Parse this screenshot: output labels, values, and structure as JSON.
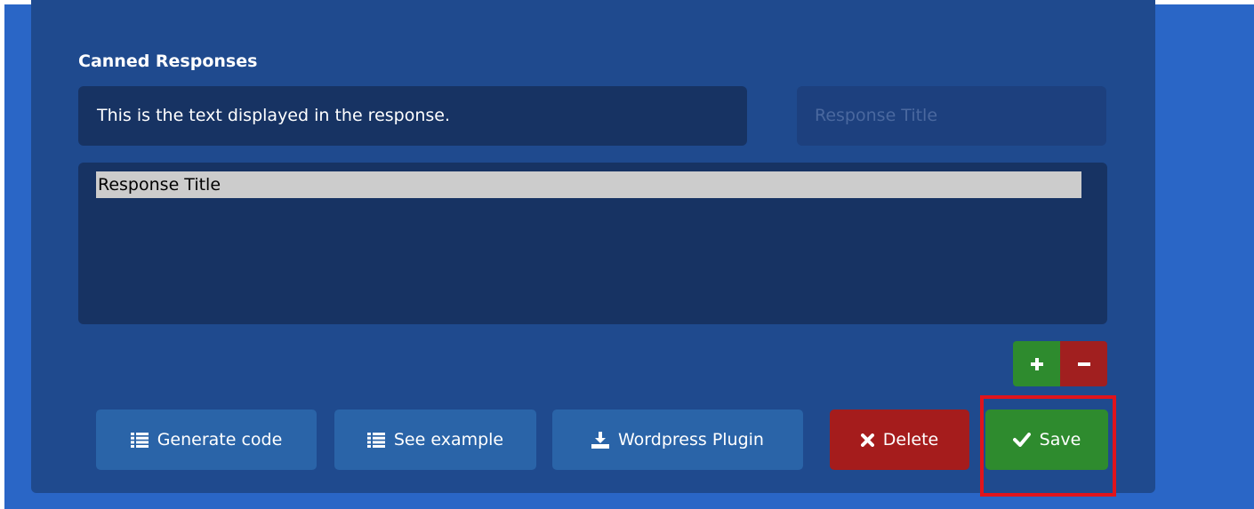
{
  "colors": {
    "page_bg": "#2a66c6",
    "panel_bg": "#1f4a8e",
    "input_bg": "#173363",
    "button_blue": "#2a64a8",
    "button_red": "#a51c1c",
    "button_green": "#2e8b2e",
    "highlight": "#e0141c"
  },
  "section_title": "Canned Responses",
  "response_text": {
    "value": "This is the text displayed in the response."
  },
  "response_title_input": {
    "placeholder": "Response Title"
  },
  "responses_list": {
    "items": [
      {
        "label": "Response Title",
        "selected": true
      }
    ]
  },
  "list_controls": {
    "add_icon": "plus-icon",
    "remove_icon": "minus-icon"
  },
  "buttons": {
    "generate_code": {
      "label": "Generate code",
      "icon": "list-icon"
    },
    "see_example": {
      "label": "See example",
      "icon": "list-icon"
    },
    "wordpress_plugin": {
      "label": "Wordpress Plugin",
      "icon": "download-icon"
    },
    "delete": {
      "label": "Delete",
      "icon": "close-icon"
    },
    "save": {
      "label": "Save",
      "icon": "check-icon"
    }
  }
}
